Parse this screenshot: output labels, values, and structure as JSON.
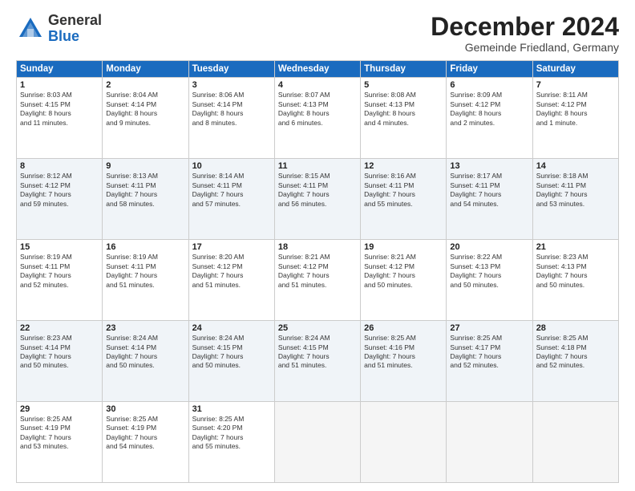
{
  "logo": {
    "general": "General",
    "blue": "Blue"
  },
  "title": {
    "month": "December 2024",
    "location": "Gemeinde Friedland, Germany"
  },
  "headers": [
    "Sunday",
    "Monday",
    "Tuesday",
    "Wednesday",
    "Thursday",
    "Friday",
    "Saturday"
  ],
  "weeks": [
    [
      {
        "day": "1",
        "lines": [
          "Sunrise: 8:03 AM",
          "Sunset: 4:15 PM",
          "Daylight: 8 hours",
          "and 11 minutes."
        ]
      },
      {
        "day": "2",
        "lines": [
          "Sunrise: 8:04 AM",
          "Sunset: 4:14 PM",
          "Daylight: 8 hours",
          "and 9 minutes."
        ]
      },
      {
        "day": "3",
        "lines": [
          "Sunrise: 8:06 AM",
          "Sunset: 4:14 PM",
          "Daylight: 8 hours",
          "and 8 minutes."
        ]
      },
      {
        "day": "4",
        "lines": [
          "Sunrise: 8:07 AM",
          "Sunset: 4:13 PM",
          "Daylight: 8 hours",
          "and 6 minutes."
        ]
      },
      {
        "day": "5",
        "lines": [
          "Sunrise: 8:08 AM",
          "Sunset: 4:13 PM",
          "Daylight: 8 hours",
          "and 4 minutes."
        ]
      },
      {
        "day": "6",
        "lines": [
          "Sunrise: 8:09 AM",
          "Sunset: 4:12 PM",
          "Daylight: 8 hours",
          "and 2 minutes."
        ]
      },
      {
        "day": "7",
        "lines": [
          "Sunrise: 8:11 AM",
          "Sunset: 4:12 PM",
          "Daylight: 8 hours",
          "and 1 minute."
        ]
      }
    ],
    [
      {
        "day": "8",
        "lines": [
          "Sunrise: 8:12 AM",
          "Sunset: 4:12 PM",
          "Daylight: 7 hours",
          "and 59 minutes."
        ]
      },
      {
        "day": "9",
        "lines": [
          "Sunrise: 8:13 AM",
          "Sunset: 4:11 PM",
          "Daylight: 7 hours",
          "and 58 minutes."
        ]
      },
      {
        "day": "10",
        "lines": [
          "Sunrise: 8:14 AM",
          "Sunset: 4:11 PM",
          "Daylight: 7 hours",
          "and 57 minutes."
        ]
      },
      {
        "day": "11",
        "lines": [
          "Sunrise: 8:15 AM",
          "Sunset: 4:11 PM",
          "Daylight: 7 hours",
          "and 56 minutes."
        ]
      },
      {
        "day": "12",
        "lines": [
          "Sunrise: 8:16 AM",
          "Sunset: 4:11 PM",
          "Daylight: 7 hours",
          "and 55 minutes."
        ]
      },
      {
        "day": "13",
        "lines": [
          "Sunrise: 8:17 AM",
          "Sunset: 4:11 PM",
          "Daylight: 7 hours",
          "and 54 minutes."
        ]
      },
      {
        "day": "14",
        "lines": [
          "Sunrise: 8:18 AM",
          "Sunset: 4:11 PM",
          "Daylight: 7 hours",
          "and 53 minutes."
        ]
      }
    ],
    [
      {
        "day": "15",
        "lines": [
          "Sunrise: 8:19 AM",
          "Sunset: 4:11 PM",
          "Daylight: 7 hours",
          "and 52 minutes."
        ]
      },
      {
        "day": "16",
        "lines": [
          "Sunrise: 8:19 AM",
          "Sunset: 4:11 PM",
          "Daylight: 7 hours",
          "and 51 minutes."
        ]
      },
      {
        "day": "17",
        "lines": [
          "Sunrise: 8:20 AM",
          "Sunset: 4:12 PM",
          "Daylight: 7 hours",
          "and 51 minutes."
        ]
      },
      {
        "day": "18",
        "lines": [
          "Sunrise: 8:21 AM",
          "Sunset: 4:12 PM",
          "Daylight: 7 hours",
          "and 51 minutes."
        ]
      },
      {
        "day": "19",
        "lines": [
          "Sunrise: 8:21 AM",
          "Sunset: 4:12 PM",
          "Daylight: 7 hours",
          "and 50 minutes."
        ]
      },
      {
        "day": "20",
        "lines": [
          "Sunrise: 8:22 AM",
          "Sunset: 4:13 PM",
          "Daylight: 7 hours",
          "and 50 minutes."
        ]
      },
      {
        "day": "21",
        "lines": [
          "Sunrise: 8:23 AM",
          "Sunset: 4:13 PM",
          "Daylight: 7 hours",
          "and 50 minutes."
        ]
      }
    ],
    [
      {
        "day": "22",
        "lines": [
          "Sunrise: 8:23 AM",
          "Sunset: 4:14 PM",
          "Daylight: 7 hours",
          "and 50 minutes."
        ]
      },
      {
        "day": "23",
        "lines": [
          "Sunrise: 8:24 AM",
          "Sunset: 4:14 PM",
          "Daylight: 7 hours",
          "and 50 minutes."
        ]
      },
      {
        "day": "24",
        "lines": [
          "Sunrise: 8:24 AM",
          "Sunset: 4:15 PM",
          "Daylight: 7 hours",
          "and 50 minutes."
        ]
      },
      {
        "day": "25",
        "lines": [
          "Sunrise: 8:24 AM",
          "Sunset: 4:15 PM",
          "Daylight: 7 hours",
          "and 51 minutes."
        ]
      },
      {
        "day": "26",
        "lines": [
          "Sunrise: 8:25 AM",
          "Sunset: 4:16 PM",
          "Daylight: 7 hours",
          "and 51 minutes."
        ]
      },
      {
        "day": "27",
        "lines": [
          "Sunrise: 8:25 AM",
          "Sunset: 4:17 PM",
          "Daylight: 7 hours",
          "and 52 minutes."
        ]
      },
      {
        "day": "28",
        "lines": [
          "Sunrise: 8:25 AM",
          "Sunset: 4:18 PM",
          "Daylight: 7 hours",
          "and 52 minutes."
        ]
      }
    ],
    [
      {
        "day": "29",
        "lines": [
          "Sunrise: 8:25 AM",
          "Sunset: 4:19 PM",
          "Daylight: 7 hours",
          "and 53 minutes."
        ]
      },
      {
        "day": "30",
        "lines": [
          "Sunrise: 8:25 AM",
          "Sunset: 4:19 PM",
          "Daylight: 7 hours",
          "and 54 minutes."
        ]
      },
      {
        "day": "31",
        "lines": [
          "Sunrise: 8:25 AM",
          "Sunset: 4:20 PM",
          "Daylight: 7 hours",
          "and 55 minutes."
        ]
      },
      null,
      null,
      null,
      null
    ]
  ]
}
